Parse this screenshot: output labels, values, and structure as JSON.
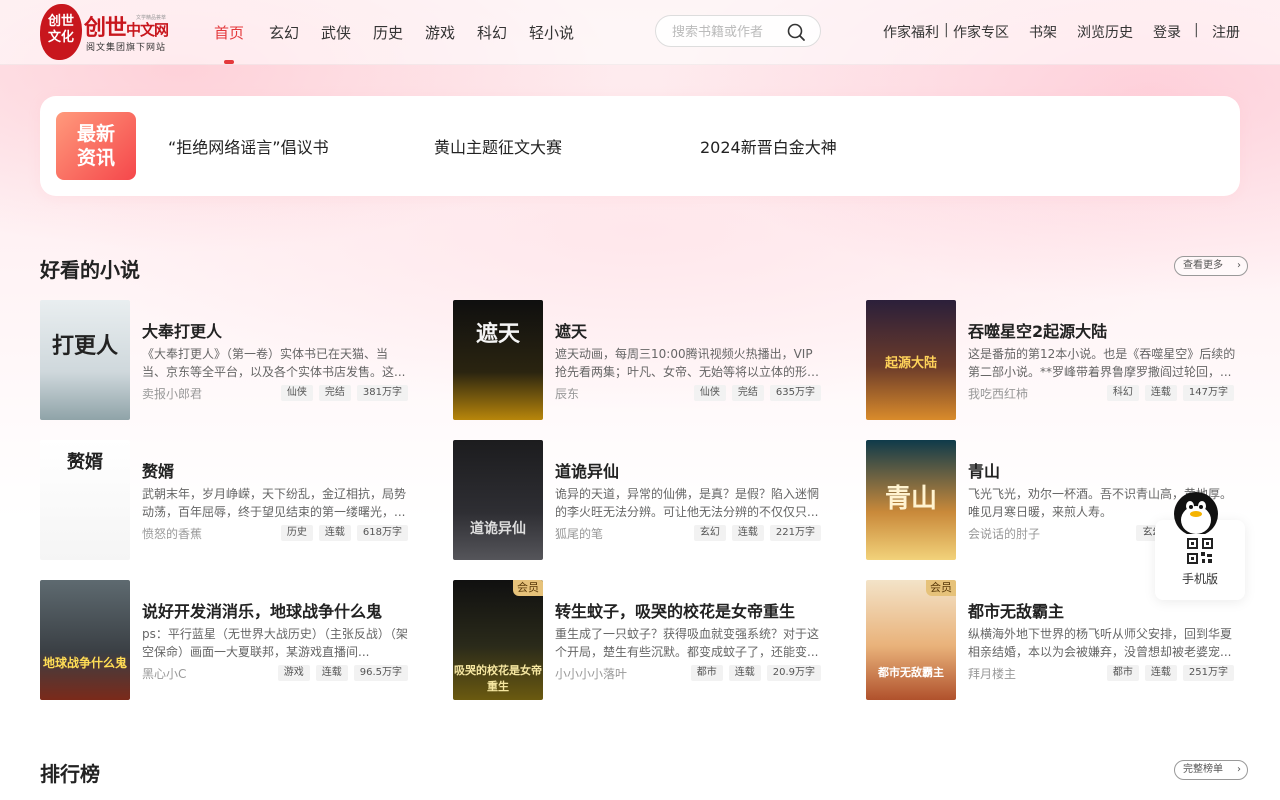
{
  "header": {
    "logo": {
      "seal_text": "创世文化",
      "name": "创世",
      "name_cn": "中文网",
      "subtitle": "阅文集团旗下网站",
      "tiny_text": "文学精品荟萃"
    },
    "nav": [
      {
        "label": "首页",
        "active": true
      },
      {
        "label": "玄幻",
        "active": false
      },
      {
        "label": "武侠",
        "active": false
      },
      {
        "label": "历史",
        "active": false
      },
      {
        "label": "游戏",
        "active": false
      },
      {
        "label": "科幻",
        "active": false
      },
      {
        "label": "轻小说",
        "active": false
      }
    ],
    "search": {
      "placeholder": "搜索书籍或作者",
      "value": ""
    },
    "links": {
      "writer_welfare": "作家福利",
      "sep1": "|",
      "writer_zone": "作家专区",
      "bookshelf": "书架",
      "history": "浏览历史",
      "login": "登录",
      "sep2": "|",
      "register": "注册"
    }
  },
  "news": {
    "badge": "最新资讯",
    "items": [
      "“拒绝网络谣言”倡议书",
      "黄山主题征文大赛",
      "2024新晋白金大神"
    ]
  },
  "section_good": {
    "title": "好看的小说",
    "more": "查看更多",
    "books": [
      {
        "title": "大奉打更人",
        "desc": "《大奉打更人》（第一卷）实体书已在天猫、当当、京东等全平台，以及各个实体书店发售。这...",
        "author": "卖报小郎君",
        "tags": [
          "仙侠",
          "完结",
          "381万字"
        ],
        "cover_text": "打更人",
        "vip": false
      },
      {
        "title": "遮天",
        "desc": "遮天动画，每周三10:00腾讯视频火热播出，VIP抢先看两集；叶凡、女帝、无始等将以立体的形式...",
        "author": "辰东",
        "tags": [
          "仙侠",
          "完结",
          "635万字"
        ],
        "cover_text": "遮天",
        "vip": false
      },
      {
        "title": "吞噬星空2起源大陆",
        "desc": "这是番茄的第12本小说。也是《吞噬星空》后续的第二部小说。**罗峰带着界鲁摩罗撒阎过轮回，...",
        "author": "我吃西红柿",
        "tags": [
          "科幻",
          "连载",
          "147万字"
        ],
        "cover_text": "起源大陆",
        "vip": false
      },
      {
        "title": "赘婿",
        "desc": "武朝末年，岁月峥嵘，天下纷乱，金辽相抗，局势动荡，百年屈辱，终于望见结束的第一缕曙光，...",
        "author": "愤怒的香蕉",
        "tags": [
          "历史",
          "连载",
          "618万字"
        ],
        "cover_text": "赘婿",
        "vip": false
      },
      {
        "title": "道诡异仙",
        "desc": "诡异的天道，异常的仙佛，是真？是假？陷入迷惘的李火旺无法分辨。可让他无法分辨的不仅仅只...",
        "author": "狐尾的笔",
        "tags": [
          "玄幻",
          "连载",
          "221万字"
        ],
        "cover_text": "道诡异仙",
        "vip": false
      },
      {
        "title": "青山",
        "desc": "飞光飞光，劝尔一杯酒。吾不识青山高，黄地厚。唯见月寒日暖，来煎人寿。",
        "author": "会说话的肘子",
        "tags": [
          "玄幻",
          "连载",
          "..."
        ],
        "cover_text": "青山",
        "vip": false
      },
      {
        "title": "说好开发消消乐，地球战争什么鬼",
        "desc": "ps：平行蓝星（无世界大战历史）（主张反战）（架空保命）画面一大夏联邦，某游戏直播间...",
        "author": "黑心小C",
        "tags": [
          "游戏",
          "连载",
          "96.5万字"
        ],
        "cover_text": "地球战争什么鬼",
        "vip": false
      },
      {
        "title": "转生蚊子，吸哭的校花是女帝重生",
        "desc": "重生成了一只蚊子？获得吸血就变强系统？对于这个开局，楚生有些沉默。都变成蚊子了，还能变...",
        "author": "小小小小落叶",
        "tags": [
          "都市",
          "连载",
          "20.9万字"
        ],
        "cover_text": "吸哭的校花是女帝重生",
        "vip": true,
        "vip_label": "会员"
      },
      {
        "title": "都市无敌霸主",
        "desc": "纵横海外地下世界的杨飞听从师父安排，回到华夏相亲结婚，本以为会被嫌弃，没曾想却被老婆宠...",
        "author": "拜月楼主",
        "tags": [
          "都市",
          "连载",
          "251万字"
        ],
        "cover_text": "都市无敌霸主",
        "vip": true,
        "vip_label": "会员"
      }
    ]
  },
  "section_rank": {
    "title": "排行榜",
    "more": "完整榜单"
  },
  "mobile": {
    "label": "手机版"
  },
  "colors": {
    "accent": "#e4393c",
    "brand": "#c8161d",
    "vip": "#e6c27a"
  }
}
